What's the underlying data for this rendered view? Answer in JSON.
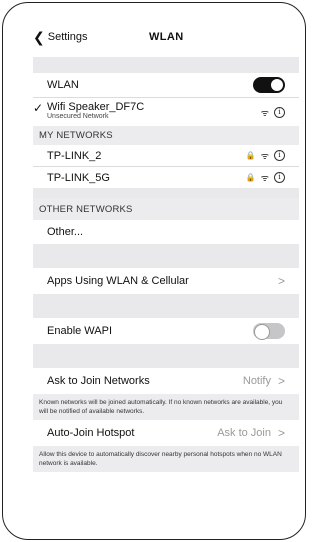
{
  "nav": {
    "back_label": "Settings",
    "title": "WLAN"
  },
  "wlan_row": {
    "label": "WLAN",
    "toggle_on": true
  },
  "connected": {
    "name": "Wifi Speaker_DF7C",
    "status": "Unsecured Network"
  },
  "my_networks": {
    "header": "MY NETWORKS",
    "items": [
      {
        "name": "TP-LINK_2"
      },
      {
        "name": "TP-LINK_5G"
      }
    ]
  },
  "other_networks": {
    "header": "OTHER NETWORKS",
    "other_label": "Other..."
  },
  "apps_row": {
    "label": "Apps Using WLAN & Cellular",
    "chevron": ">"
  },
  "wapi_row": {
    "label": "Enable WAPI",
    "toggle_on": false
  },
  "ask_row": {
    "label": "Ask to Join Networks",
    "value": "Notify",
    "chevron": ">",
    "footnote": "Known networks will be joined automatically. If no known networks are available, you will be notified of available networks."
  },
  "hotspot_row": {
    "label": "Auto-Join Hotspot",
    "value": "Ask to Join",
    "chevron": ">",
    "footnote": "Allow this device to automatically discover nearby personal hotspots when no WLAN network is available."
  },
  "glyphs": {
    "back": "❮",
    "check": "✓",
    "wifi": "ᯤ",
    "lock": "🔒",
    "info": "i"
  }
}
